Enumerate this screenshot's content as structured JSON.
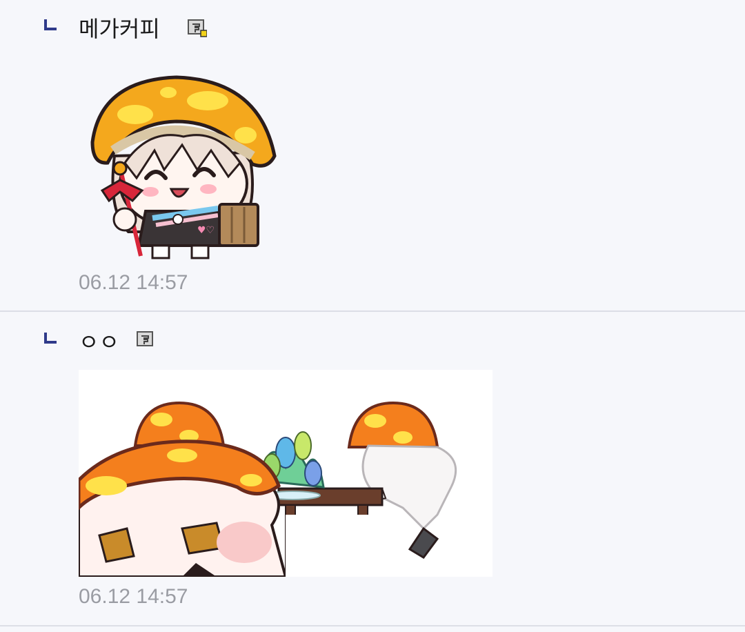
{
  "comments": [
    {
      "nickname": "메가커피",
      "user_icon": "fixed-nick-icon-gold",
      "content_type": "sticker",
      "sticker_name": "mushroom-girl-sticker",
      "timestamp": "06.12 14:57"
    },
    {
      "nickname": "ㅇㅇ",
      "user_icon": "fixed-nick-icon-gray",
      "content_type": "sticker",
      "sticker_name": "mushroom-table-sticker",
      "timestamp": "06.12 14:57"
    }
  ],
  "colors": {
    "background": "#f6f7fb",
    "reply_mark": "#2f3a8a",
    "timestamp": "#9a9ca3",
    "divider": "#dcdee6",
    "mushroom_orange": "#f4a81d",
    "mushroom_spot": "#ffe14a"
  }
}
